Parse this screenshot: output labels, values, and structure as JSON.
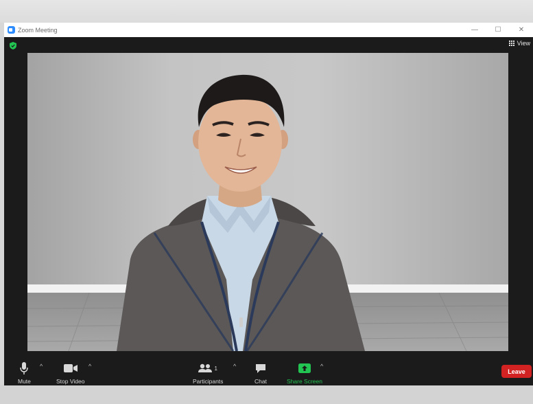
{
  "window": {
    "title": "Zoom Meeting"
  },
  "window_controls": {
    "minimize": "—",
    "maximize": "☐",
    "close": "✕"
  },
  "top": {
    "view_label": "View"
  },
  "toolbar": {
    "mute_label": "Mute",
    "stop_video_label": "Stop Video",
    "participants_label": "Participants",
    "participants_count": "1",
    "chat_label": "Chat",
    "share_screen_label": "Share Screen",
    "leave_label": "Leave",
    "caret": "^"
  },
  "icons": {
    "security": "shield-check-icon",
    "view": "grid-icon",
    "mute": "microphone-icon",
    "video": "video-camera-icon",
    "participants": "people-icon",
    "chat": "speech-bubble-icon",
    "share": "share-screen-arrow-icon"
  },
  "colors": {
    "security_green": "#23c552",
    "share_green": "#23c552",
    "leave_red": "#d32222",
    "toolbar_bg": "#1b1b1b"
  }
}
